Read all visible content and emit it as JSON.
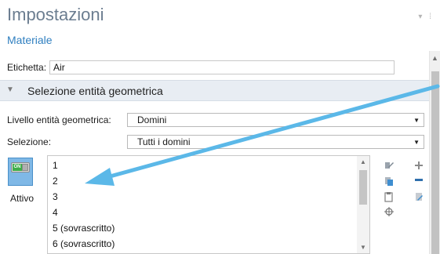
{
  "header": {
    "title": "Impostazioni",
    "subtitle": "Materiale"
  },
  "label_field": {
    "label": "Etichetta:",
    "value": "Air"
  },
  "section": {
    "title": "Selezione entità geometrica"
  },
  "geometric_level": {
    "label": "Livello entità geometrica:",
    "selected": "Domini"
  },
  "selection": {
    "label": "Selezione:",
    "selected": "Tutti i domini"
  },
  "active_toggle": {
    "on_text": "ON",
    "label": "Attivo"
  },
  "domain_list": {
    "items": [
      "1",
      "2",
      "3",
      "4",
      "5 (sovrascritto)",
      "6 (sovrascritto)"
    ]
  },
  "tools": {
    "icons": [
      "paste-selection-icon",
      "copy-selection-icon",
      "clipboard-icon",
      "zoom-selection-icon",
      "add-icon",
      "remove-icon",
      "clear-selection-icon"
    ]
  },
  "colors": {
    "title": "#6b7d90",
    "subtitle": "#2f7fc0",
    "section_bg": "#e8edf3",
    "toggle_bg": "#7fb8e6",
    "annotation_arrow": "#5bb8e8"
  }
}
